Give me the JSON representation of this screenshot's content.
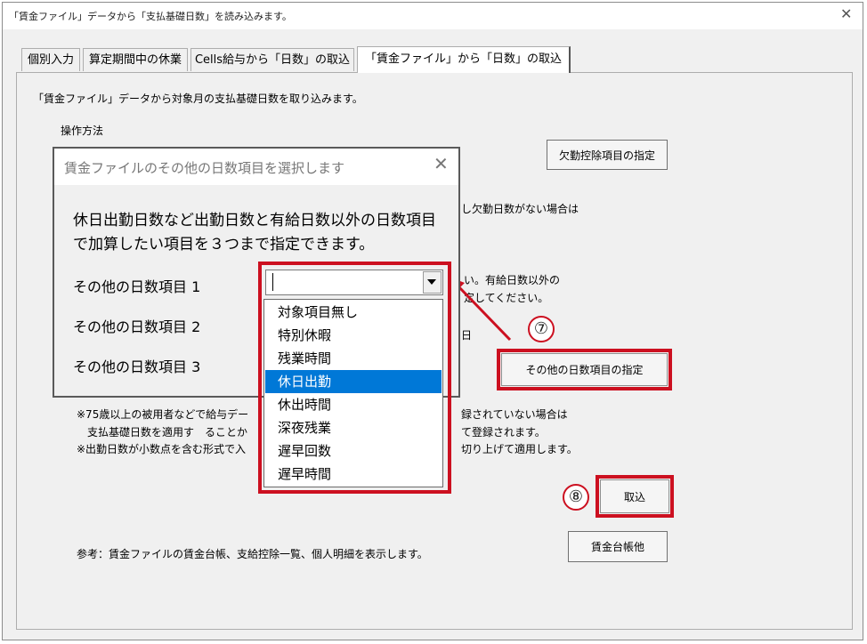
{
  "window": {
    "title": "「賃金ファイル」データから「支払基礎日数」を読み込みます。",
    "close_icon": "close-icon"
  },
  "tabs": [
    {
      "label": "個別入力",
      "active": false
    },
    {
      "label": "算定期間中の休業",
      "active": false
    },
    {
      "label": "Cells給与から「日数」の取込",
      "active": false
    },
    {
      "label": "「賃金ファイル」から「日数」の取込",
      "active": true
    }
  ],
  "panel": {
    "intro": "「賃金ファイル」データから対象月の支払基礎日数を取り込みます。",
    "method_label": "操作方法",
    "absence_button": "欠勤控除項目の指定",
    "partial_line1": "し欠勤日数がない場合は",
    "partial_line2": "い。有給日数以外の",
    "partial_line3": "定してください。",
    "partial_line4": "日",
    "other_days_button": "その他の日数項目の指定",
    "note1_left": "※75歳以上の被用者などで給与デー",
    "note1_right": "録されていない場合は",
    "note2_left": "支払基礎日数を適用す　ることか",
    "note2_right": "て登録されます。",
    "note3_left": "※出勤日数が小数点を含む形式で入",
    "note3_right": "切り上げて適用します。",
    "import_button": "取込",
    "reference_text": "参考：賃金ファイルの賃金台帳、支給控除一覧、個人明細を表示します。",
    "ledger_button": "賃金台帳他"
  },
  "dialog": {
    "title": "賃金ファイルのその他の日数項目を選択します",
    "description_line1": "休日出勤日数など出勤日数と有給日数以外の日数項目",
    "description_line2": "で加算したい項目を３つまで指定できます。",
    "field1_label": "その他の日数項目 1",
    "field2_label": "その他の日数項目 2",
    "field3_label": "その他の日数項目 3",
    "combo_value": "",
    "options": [
      "対象項目無し",
      "特別休暇",
      "残業時間",
      "休日出勤",
      "休出時間",
      "深夜残業",
      "遅早回数",
      "遅早時間"
    ],
    "selected_option": "休日出勤"
  },
  "annotations": {
    "step7": "⑦",
    "step8": "⑧"
  },
  "colors": {
    "highlight_red": "#cc1020",
    "selection_blue": "#0078d7"
  }
}
